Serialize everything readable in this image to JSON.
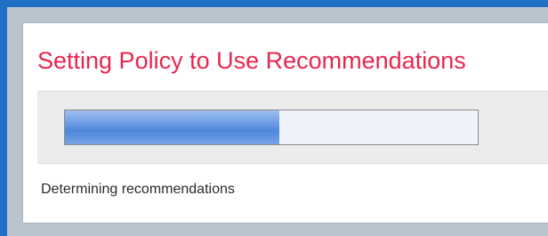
{
  "dialog": {
    "title": "Setting Policy to Use Recommendations",
    "status_text": "Determining recommendations",
    "progress": 0.52
  },
  "colors": {
    "title": "#e8264e",
    "progress_fill": "#5b8fde",
    "frame_border": "#1f6fc4"
  }
}
